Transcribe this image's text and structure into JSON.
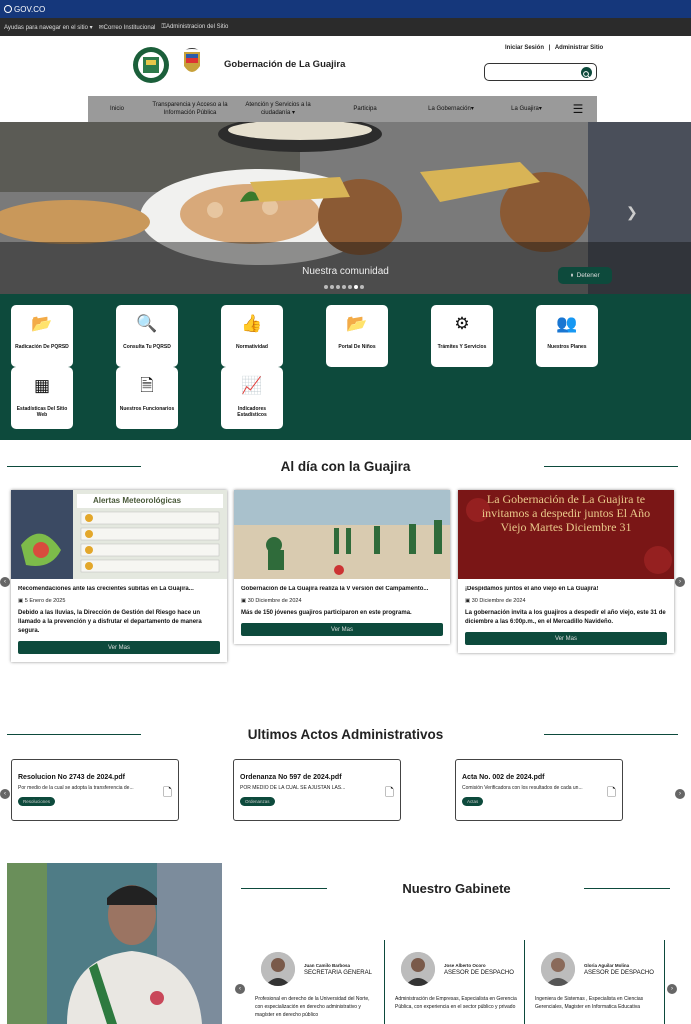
{
  "govbar": {
    "label": "GOV.CO"
  },
  "access": {
    "help": "Ayudas para navegar en el sitio",
    "mail": "Correo Institucional",
    "admin": "Administracion del Sitio"
  },
  "header": {
    "title": "Gobernación de La Guajira",
    "login": "Iniciar Sesión",
    "separator": "|",
    "admin": "Administrar Sitio"
  },
  "nav": [
    {
      "label": "Inicio"
    },
    {
      "label": "Transparencia y Acceso a la Información Pública"
    },
    {
      "label": "Atención y Servicios a la ciudadanía"
    },
    {
      "label": "Participa"
    },
    {
      "label": "La Gobernación"
    },
    {
      "label": "La Guajira"
    }
  ],
  "hero": {
    "caption": "Nuestra comunidad",
    "stop": "Detener"
  },
  "tiles": [
    {
      "label": "Radicación De PQRSD",
      "icon": "folder-open-icon",
      "glyph": "📂"
    },
    {
      "label": "Consulta Tu PQRSD",
      "icon": "search-icon",
      "glyph": "🔍"
    },
    {
      "label": "Normatividad",
      "icon": "thumbs-up-icon",
      "glyph": "👍"
    },
    {
      "label": "Portal De Niños",
      "icon": "folder-open-icon",
      "glyph": "📂"
    },
    {
      "label": "Trámites Y Servicios",
      "icon": "gears-icon",
      "glyph": "⚙"
    },
    {
      "label": "Nuestros Planes",
      "icon": "users-icon",
      "glyph": "👥"
    },
    {
      "label": "Estadísticas Del Sitio Web",
      "icon": "bar-chart-icon",
      "glyph": "▦"
    },
    {
      "label": "Nuestros Funcionarios",
      "icon": "document-icon",
      "glyph": "🗎"
    },
    {
      "label": "Indicadores Estadísticos",
      "icon": "line-chart-icon",
      "glyph": "📈"
    }
  ],
  "news": {
    "title": "Al día con la Guajira",
    "items": [
      {
        "title": "Recomendaciones ante las crecientes súbitas en La Guajira...",
        "date": "5 Enero de 2025",
        "summary": "Debido a las lluvias, la Dirección de Gestión del Riesgo hace un llamado a la prevención y a disfrutar el departamento de manera segura.",
        "button": "Ver Mas",
        "image_text": "Alertas Meteorológicas"
      },
      {
        "title": "Gobernación de La Guajira realiza la V versión del Campamento...",
        "date": "30 Diciembre de 2024",
        "summary": "Más de 150 jóvenes guajiros participaron en este programa.",
        "button": "Ver Mas",
        "image_text": ""
      },
      {
        "title": "¡Despidamos juntos el año viejo en La Guajira!",
        "date": "30 Diciembre de 2024",
        "summary": "La gobernación invita a los guajiros a despedir el año viejo, este 31 de diciembre a las 6:00p.m., en el Mercadillo Navideño.",
        "button": "Ver Mas",
        "image_text": "La Gobernación de La Guajira te invitamos a despedir juntos El Año Viejo Martes Diciembre 31"
      }
    ]
  },
  "acts": {
    "title": "Ultimos Actos Administrativos",
    "items": [
      {
        "name": "Resolucion No 2743 de 2024.pdf",
        "desc": "Por medio de la cual se adopta la transferencia de...",
        "tag": "Resoluciones"
      },
      {
        "name": "Ordenanza No 597 de 2024.pdf",
        "desc": "POR MEDIO DE LA CUAL SE AJUSTAN LAS...",
        "tag": "Ordenanzas"
      },
      {
        "name": "Acta No. 002 de 2024.pdf",
        "desc": "Comisión Verificadora con los resultados de cada un...",
        "tag": "Actas"
      }
    ]
  },
  "cabinet": {
    "title": "Nuestro Gabinete",
    "members": [
      {
        "name": "Juan Camilo Barbosa",
        "role": "SECRETARIA GENERAL",
        "desc": "Profesional en derecho de la Universidad del Norte, con especialización en derecho administrativo y magíster en derecho público"
      },
      {
        "name": "Jose Alberto Ocoro",
        "role": "ASESOR DE DESPACHO",
        "desc": "Administración de Empresas, Especialista en Gerencia Pública, con experiencia en el sector público y privado"
      },
      {
        "name": "Gloria Aguilar Molina",
        "role": "ASESOR DE DESPACHO",
        "desc": "Ingeniera de Sistemas , Especialista en Ciencias Gerenciales, Magister en Informatica Educativa"
      }
    ]
  },
  "colors": {
    "primary": "#0d4a3c",
    "govbar": "#15377b"
  }
}
